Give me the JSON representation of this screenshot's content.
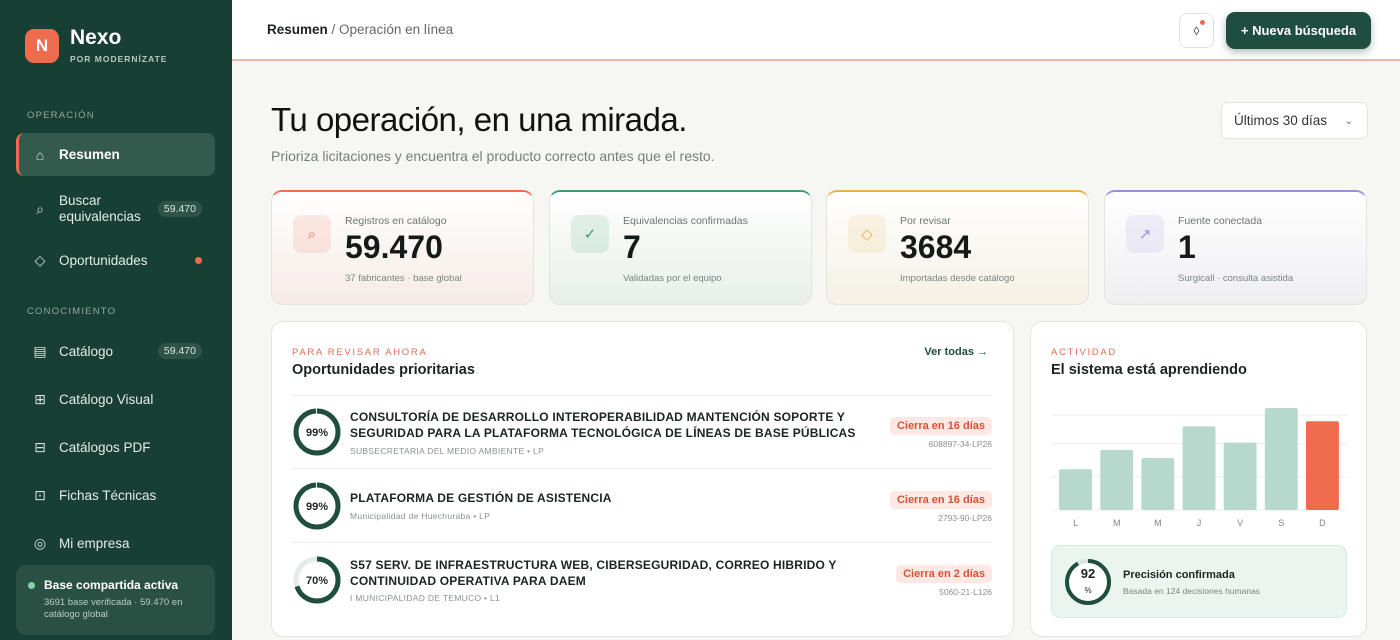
{
  "brand": {
    "logo_letter": "N",
    "name": "Nexo",
    "subtitle": "POR MODERNÍZATE"
  },
  "sidebar": {
    "section_operation": "OPERACIÓN",
    "section_knowledge": "CONOCIMIENTO",
    "items": [
      {
        "label": "Resumen",
        "icon": "home-icon",
        "active": true
      },
      {
        "label": "Buscar equivalencias",
        "icon": "search-icon",
        "badge": "59.470"
      },
      {
        "label": "Oportunidades",
        "icon": "diamond-icon",
        "dot": true
      },
      {
        "label": "Catálogo",
        "icon": "list-icon",
        "badge": "59.470"
      },
      {
        "label": "Catálogo Visual",
        "icon": "grid-icon"
      },
      {
        "label": "Catálogos PDF",
        "icon": "document-icon"
      },
      {
        "label": "Fichas Técnicas",
        "icon": "sheet-icon"
      },
      {
        "label": "Mi empresa",
        "icon": "target-icon"
      }
    ],
    "shared": {
      "title": "Base compartida activa",
      "subtitle": "3691 base verificada · 59.470 en catálogo global"
    }
  },
  "topbar": {
    "crumb_current": "Resumen",
    "crumb_rest": "/ Operación en línea",
    "notif_glyph": "◊",
    "new_search_label": "+ Nueva búsqueda"
  },
  "hero": {
    "title": "Tu operación, en una mirada.",
    "subtitle": "Prioriza licitaciones y encuentra el producto correcto antes que el resto.",
    "range_value": "Últimos 30 días"
  },
  "kpis": [
    {
      "label": "Registros en catálogo",
      "value": "59.470",
      "note": "37 fabricantes · base global",
      "glyph": "⌕",
      "accent": "#ee6c4d"
    },
    {
      "label": "Equivalencias confirmadas",
      "value": "7",
      "note": "Validadas por el equipo",
      "glyph": "✓",
      "accent": "#3b9a72"
    },
    {
      "label": "Por revisar",
      "value": "3684",
      "note": "Importadas desde catálogo",
      "glyph": "◇",
      "accent": "#e6b04a"
    },
    {
      "label": "Fuente conectada",
      "value": "1",
      "note": "Surgicall · consulta asistida",
      "glyph": "↗",
      "accent": "#9b8ee0"
    }
  ],
  "opportunities": {
    "eyebrow": "PARA REVISAR AHORA",
    "title": "Oportunidades prioritarias",
    "see_all": "Ver todas →",
    "items": [
      {
        "score": 0.99,
        "score_label": "99%",
        "title": "CONSULTORÍA DE DESARROLLO INTEROPERABILIDAD MANTENCIÓN SOPORTE Y SEGURIDAD PARA LA PLATAFORMA TECNOLÓGICA DE LÍNEAS DE BASE PÚBLICAS",
        "meta": "SUBSECRETARIA DEL MEDIO AMBIENTE   •   LP",
        "deadline": "Cierra en 16 días",
        "code": "608897-34-LP26"
      },
      {
        "score": 0.99,
        "score_label": "99%",
        "title": "PLATAFORMA DE GESTIÓN DE ASISTENCIA",
        "meta": "Municipalidad de Huechuraba   •   LP",
        "deadline": "Cierra en 16 días",
        "code": "2793-90-LP26"
      },
      {
        "score": 0.7,
        "score_label": "70%",
        "title": "S57 SERV. DE INFRAESTRUCTURA WEB, CIBERSEGURIDAD, CORREO HIBRIDO Y CONTINUIDAD OPERATIVA PARA DAEM",
        "meta": "I MUNICIPALIDAD DE TEMUCO   •   L1",
        "deadline": "Cierra en 2 días",
        "code": "5060-21-L126"
      }
    ]
  },
  "activity": {
    "eyebrow": "ACTIVIDAD",
    "title": "El sistema está aprendiendo",
    "precision_value": "92",
    "precision_unit": "%",
    "precision_fraction": 0.92,
    "precision_title": "Precisión confirmada",
    "precision_sub": "Basada en 124 decisiones humanas"
  },
  "chart_data": {
    "type": "bar",
    "title": "",
    "categories": [
      "L",
      "M",
      "M",
      "J",
      "V",
      "S",
      "D"
    ],
    "values": [
      40,
      59,
      51,
      82,
      66,
      100,
      87
    ],
    "ylim": [
      0,
      100
    ],
    "colors": {
      "default": "#b7d8cc",
      "highlight": "#ee6c4d"
    },
    "highlight_index": 6,
    "grid": true
  }
}
